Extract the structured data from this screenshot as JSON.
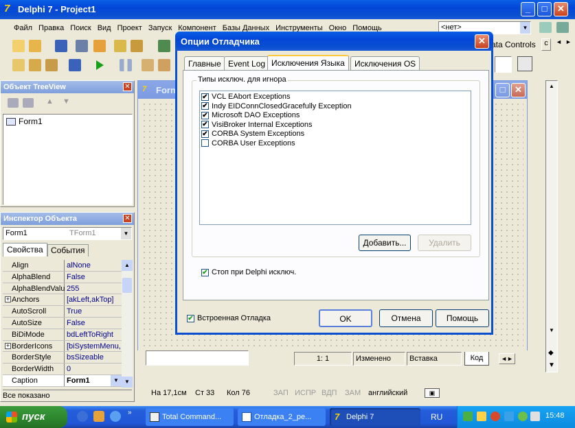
{
  "main_window": {
    "title": "Delphi 7 - Project1"
  },
  "menu": [
    "Файл",
    "Правка",
    "Поиск",
    "Вид",
    "Проект",
    "Запуск",
    "Компонент",
    "Базы Данных",
    "Инструменты",
    "Окно",
    "Помощь"
  ],
  "component_combo": {
    "value": "<нет>"
  },
  "palette_tabs": [
    "ata Controls",
    "c"
  ],
  "treeview": {
    "title": "Объект TreeView",
    "node": "Form1"
  },
  "inspector": {
    "title": "Инспектор Объекта",
    "object": "Form1",
    "object_type": "TForm1",
    "tabs": [
      "Свойства",
      "События"
    ],
    "rows": [
      {
        "key": "Align",
        "value": "alNone",
        "expand": false
      },
      {
        "key": "AlphaBlend",
        "value": "False",
        "expand": false
      },
      {
        "key": "AlphaBlendValu",
        "value": "255",
        "expand": false
      },
      {
        "key": "Anchors",
        "value": "[akLeft,akTop]",
        "expand": true
      },
      {
        "key": "AutoScroll",
        "value": "True",
        "expand": false
      },
      {
        "key": "AutoSize",
        "value": "False",
        "expand": false
      },
      {
        "key": "BiDiMode",
        "value": "bdLeftToRight",
        "expand": false
      },
      {
        "key": "BorderIcons",
        "value": "[biSystemMenu,",
        "expand": true
      },
      {
        "key": "BorderStyle",
        "value": "bsSizeable",
        "expand": false
      },
      {
        "key": "BorderWidth",
        "value": "0",
        "expand": false
      },
      {
        "key": "Caption",
        "value": "Form1",
        "expand": false
      }
    ],
    "status": "Все показано"
  },
  "form_window": {
    "title": "Form1"
  },
  "editor_status": {
    "pos": "1:  1",
    "modified": "Изменено",
    "mode": "Вставка",
    "tab": "Код"
  },
  "ide_status": {
    "size": "На 17,1см",
    "line": "Ст 33",
    "col": "Кол 76",
    "zap": "ЗАП",
    "ispr": "ИСПР",
    "vdp": "ВДП",
    "zam": "ЗАМ",
    "lang": "английский"
  },
  "dialog": {
    "title": "Опции Отладчика",
    "tabs": [
      "Главные",
      "Event Log",
      "Исключения Языка",
      "Исключения OS"
    ],
    "active_tab": 2,
    "group_label": "Типы исключ. для игнора",
    "exceptions": [
      {
        "label": "VCL EAbort Exceptions",
        "checked": true
      },
      {
        "label": "Indy EIDConnClosedGracefully Exception",
        "checked": true
      },
      {
        "label": "Microsoft DAO Exceptions",
        "checked": true
      },
      {
        "label": "VisiBroker Internal Exceptions",
        "checked": true
      },
      {
        "label": "CORBA System Exceptions",
        "checked": true
      },
      {
        "label": "CORBA User Exceptions",
        "checked": false
      }
    ],
    "add_button": "Добавить...",
    "remove_button": "Удалить",
    "stop_checkbox": {
      "label": "Стоп при Delphi исключ.",
      "checked": true
    },
    "integrated_debug": {
      "label": "Встроенная Отладка",
      "checked": true
    },
    "ok_button": "OK",
    "cancel_button": "Отмена",
    "help_button": "Помощь"
  },
  "taskbar": {
    "start": "пуск",
    "items": [
      "Total Command...",
      "Отладка_2_ре...",
      "Delphi 7"
    ],
    "active_item": 2,
    "lang": "RU",
    "clock": "15:48"
  }
}
